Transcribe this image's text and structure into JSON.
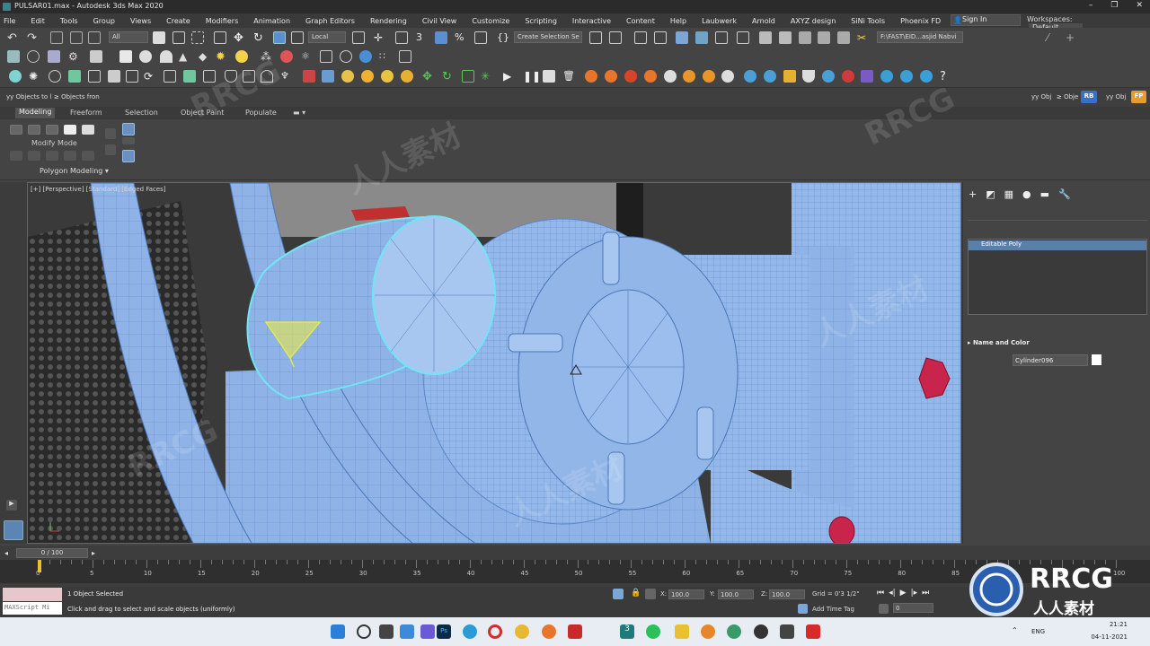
{
  "window": {
    "title": "PULSAR01.max - Autodesk 3ds Max 2020",
    "controls": [
      "–",
      "❐",
      "✕"
    ]
  },
  "menu": {
    "items": [
      "File",
      "Edit",
      "Tools",
      "Group",
      "Views",
      "Create",
      "Modifiers",
      "Animation",
      "Graph Editors",
      "Rendering",
      "Civil View",
      "Customize",
      "Scripting",
      "Interactive",
      "Content",
      "Help",
      "Laubwerk",
      "Arnold",
      "AXYZ design",
      "SiNi Tools",
      "Phoenix FD"
    ],
    "sign_in": "Sign In",
    "workspaces_label": "Workspaces:",
    "workspaces_value": "Default"
  },
  "toolbar": {
    "selection_filter": "All",
    "ref_coord": "Local",
    "named_selection": "Create Selection Se",
    "project_path": "F:\\FAST\\EID...asjid Nabvi",
    "row4_left": [
      "yy Objects to l",
      "≥ Objects fron"
    ],
    "row4_right": [
      "yy Obj",
      "≥ Obje",
      "RB",
      "yy Obj",
      "FP"
    ]
  },
  "ribbon": {
    "tabs": [
      "Modeling",
      "Freeform",
      "Selection",
      "Object Paint",
      "Populate"
    ],
    "active_tab": "Modeling",
    "modify_mode": "Modify Mode",
    "polygon_modeling": "Polygon Modeling ▾"
  },
  "viewport": {
    "label": "[+] [Perspective] [Standard] [Edged Faces]"
  },
  "command_panel": {
    "modifier_stack": [
      "Editable Poly"
    ],
    "rollout_title": "Name and Color",
    "object_name": "Cylinder096",
    "object_color": "#ffffff"
  },
  "timeline": {
    "frame_display": "0 / 100",
    "ticks": [
      "0",
      "5",
      "10",
      "15",
      "20",
      "25",
      "30",
      "35",
      "40",
      "45",
      "50",
      "55",
      "60",
      "65",
      "70",
      "75",
      "80",
      "85",
      "90",
      "95",
      "100"
    ]
  },
  "status": {
    "maxscript_label": "MAXScript Mi",
    "selected": "1 Object Selected",
    "prompt": "Click and drag to select and scale objects (uniformly)",
    "x_label": "X:",
    "x_value": "100.0",
    "y_label": "Y:",
    "y_value": "100.0",
    "z_label": "Z:",
    "z_value": "100.0",
    "grid": "Grid = 0'3 1/2\"",
    "add_time_tag": "Add Time Tag",
    "frame_value": "0"
  },
  "taskbar": {
    "language": "ENG",
    "time": "21:21",
    "date": "04-11-2021"
  },
  "watermarks": [
    "RRCG",
    "人人素材",
    "RRCG",
    "人人素材",
    "RRCG",
    "人人素材"
  ],
  "brand_logo": {
    "text": "RRCG",
    "subtitle": "人人素材"
  },
  "colors": {
    "model_blue": "#8fb3e6",
    "wire": "#5a86c8",
    "selection_cyan": "#6fe6f5",
    "gizmo_yellow": "#e8e84a"
  }
}
